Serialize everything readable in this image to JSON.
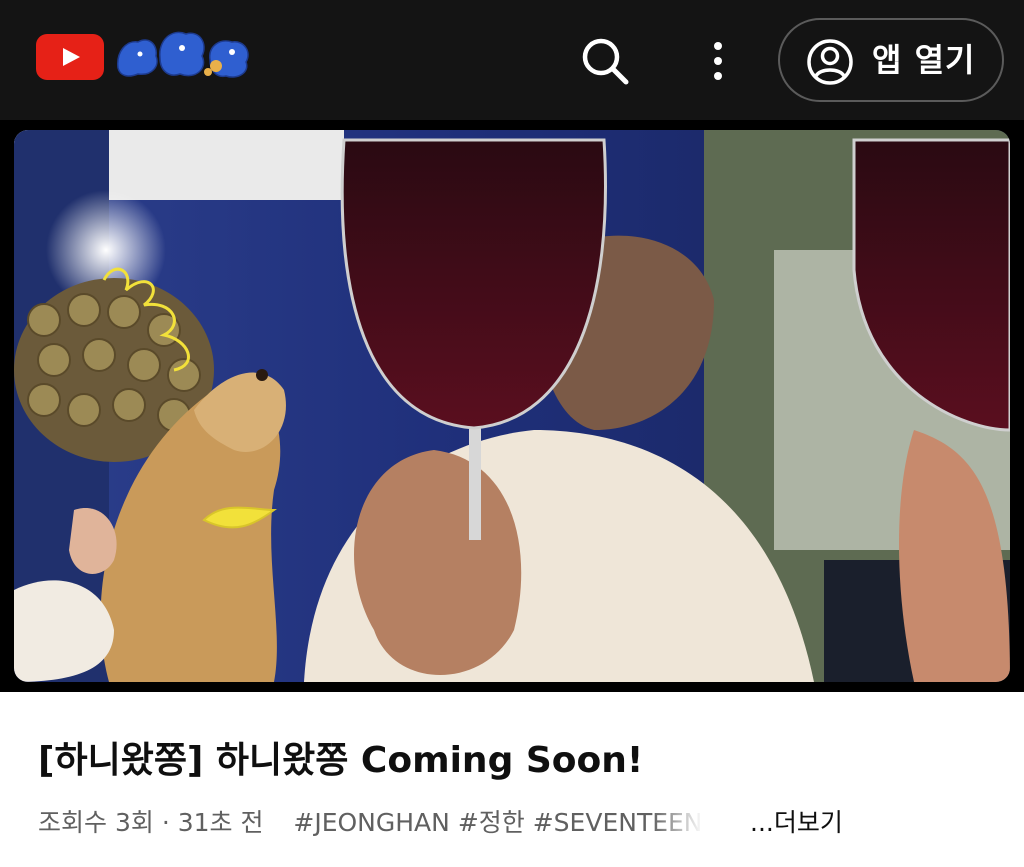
{
  "header": {
    "logo_icon": "youtube-logo-icon",
    "doodle_icon": "blue-creatures-doodle-icon",
    "search_icon": "search-icon",
    "more_icon": "more-vertical-icon",
    "open_app_icon": "account-circle-icon",
    "open_app_label": "앱 열기",
    "brand_color": "#e62117",
    "bar_color": "#141414"
  },
  "player": {
    "thumbnail_description_icon": "video-thumbnail-image"
  },
  "video": {
    "title": "[하니왔쫑] 하니왔쫑 Coming Soon!",
    "views": "조회수 3회",
    "separator": "·",
    "time_ago": "31초 전",
    "hashtags": [
      "#JEONGHAN",
      "#정한",
      "#SEVENTEEN"
    ],
    "more_label": "...더보기"
  }
}
